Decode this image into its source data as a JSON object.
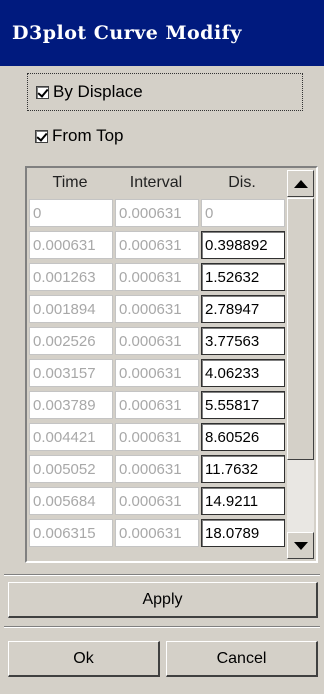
{
  "window": {
    "title": "D3plot Curve Modify"
  },
  "options": {
    "by_displace": {
      "label": "By Displace",
      "checked": true
    },
    "from_top": {
      "label": "From Top",
      "checked": true
    }
  },
  "table": {
    "columns": [
      "Time",
      "Interval",
      "Dis."
    ],
    "rows": [
      [
        "0",
        "0.000631",
        "0"
      ],
      [
        "0.000631",
        "0.000631",
        "0.398892"
      ],
      [
        "0.001263",
        "0.000631",
        "1.52632"
      ],
      [
        "0.001894",
        "0.000631",
        "2.78947"
      ],
      [
        "0.002526",
        "0.000631",
        "3.77563"
      ],
      [
        "0.003157",
        "0.000631",
        "4.06233"
      ],
      [
        "0.003789",
        "0.000631",
        "5.55817"
      ],
      [
        "0.004421",
        "0.000631",
        "8.60526"
      ],
      [
        "0.005052",
        "0.000631",
        "11.7632"
      ],
      [
        "0.005684",
        "0.000631",
        "14.9211"
      ],
      [
        "0.006315",
        "0.000631",
        "18.0789"
      ]
    ]
  },
  "buttons": {
    "apply": "Apply",
    "ok": "Ok",
    "cancel": "Cancel"
  },
  "colors": {
    "titlebar": "#001a7e",
    "face": "#d4d0c8",
    "disabled_text": "#a8a8a8"
  }
}
